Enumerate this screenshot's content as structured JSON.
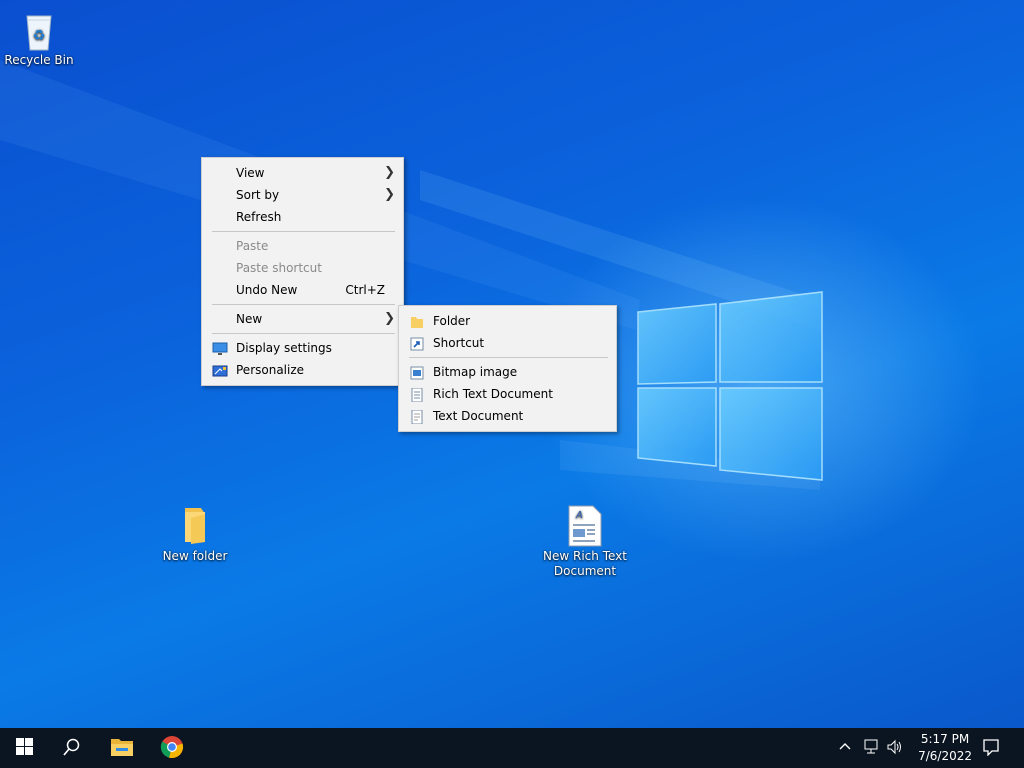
{
  "desktop": {
    "icons": [
      {
        "label": "Recycle Bin"
      },
      {
        "label": "New folder"
      },
      {
        "label": "New Rich Text Document"
      }
    ]
  },
  "context_menu": {
    "items": [
      {
        "label": "View",
        "submenu": true
      },
      {
        "label": "Sort by",
        "submenu": true
      },
      {
        "label": "Refresh"
      },
      {
        "label": "Paste",
        "disabled": true
      },
      {
        "label": "Paste shortcut",
        "disabled": true
      },
      {
        "label": "Undo New",
        "shortcut": "Ctrl+Z"
      },
      {
        "label": "New",
        "submenu": true
      },
      {
        "label": "Display settings",
        "icon": "display-icon"
      },
      {
        "label": "Personalize",
        "icon": "personalize-icon"
      }
    ]
  },
  "new_submenu": {
    "items": [
      {
        "label": "Folder",
        "icon": "folder-icon"
      },
      {
        "label": "Shortcut",
        "icon": "shortcut-icon"
      },
      {
        "label": "Bitmap image",
        "icon": "bitmap-icon"
      },
      {
        "label": "Rich Text Document",
        "icon": "rtf-document-icon"
      },
      {
        "label": "Text Document",
        "icon": "text-document-icon"
      }
    ]
  },
  "taskbar": {
    "pinned": [
      "start-icon",
      "search-icon",
      "file-explorer-icon",
      "chrome-icon"
    ],
    "tray": [
      "chevron-up-icon",
      "network-icon",
      "volume-icon"
    ],
    "clock": {
      "time": "5:17 PM",
      "date": "7/6/2022"
    },
    "notification": "action-center-icon"
  },
  "colors": {
    "desktop": "#0a63dc",
    "menu_bg": "#f2f2f2",
    "taskbar": "#0b1521"
  }
}
